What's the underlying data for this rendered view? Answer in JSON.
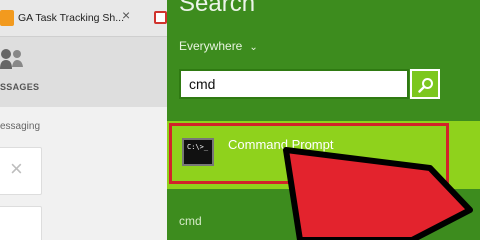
{
  "browser": {
    "tab_title": "GA Task Tracking Sh...",
    "tab_close": "×",
    "nav_label": "SSAGES",
    "section_label": "essaging",
    "card_close": "×"
  },
  "search_charm": {
    "title": "Search",
    "scope": "Everywhere",
    "scope_chevron": "⌄",
    "query": "cmd",
    "result_label": "Command Prompt",
    "result_icon_text": "C:\\>_",
    "suggestion": "cmd"
  },
  "colors": {
    "charm_bg": "#3d8c1e",
    "result_bg": "#8fd21c",
    "highlight_border": "#d2232a",
    "arrow": "#e3232d"
  }
}
